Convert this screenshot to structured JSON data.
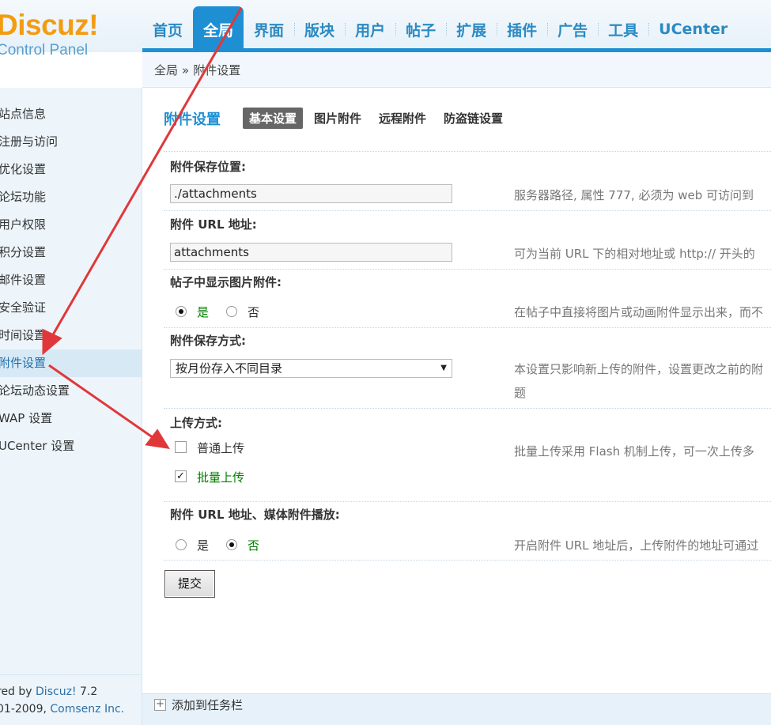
{
  "logo": {
    "brand": "Discuz!",
    "subtitle": "Control Panel"
  },
  "nav": {
    "items": [
      "首页",
      "全局",
      "界面",
      "版块",
      "用户",
      "帖子",
      "扩展",
      "插件",
      "广告",
      "工具",
      "UCenter"
    ],
    "active_index": 1
  },
  "breadcrumb": {
    "root": "全局",
    "separator": "»",
    "current": "附件设置"
  },
  "sidebar": {
    "items": [
      "站点信息",
      "注册与访问",
      "优化设置",
      "论坛功能",
      "用户权限",
      "积分设置",
      "邮件设置",
      "安全验证",
      "时间设置",
      "附件设置",
      "论坛动态设置",
      "WAP 设置",
      "UCenter 设置"
    ],
    "active_index": 9
  },
  "copyright": {
    "line1_prefix": "red by ",
    "line1_link": "Discuz!",
    "line1_suffix": " 7.2",
    "line2_prefix": "01-2009, ",
    "line2_link": "Comsenz Inc."
  },
  "page": {
    "title": "附件设置",
    "tabs": [
      "基本设置",
      "图片附件",
      "远程附件",
      "防盗链设置"
    ],
    "active_tab": 0
  },
  "form": {
    "save_path": {
      "label": "附件保存位置:",
      "value": "./attachments",
      "hint": "服务器路径, 属性 777, 必须为 web 可访问到"
    },
    "url": {
      "label": "附件 URL 地址:",
      "value": "attachments",
      "hint": "可为当前 URL 下的相对地址或 http:// 开头的"
    },
    "show_images": {
      "label": "帖子中显示图片附件:",
      "yes": "是",
      "no": "否",
      "selected": "yes",
      "hint": "在帖子中直接将图片或动画附件显示出来，而不"
    },
    "save_mode": {
      "label": "附件保存方式:",
      "value": "按月份存入不同目录",
      "hint_line1": "本设置只影响新上传的附件，设置更改之前的附",
      "hint_line2": "题"
    },
    "upload_mode": {
      "label": "上传方式:",
      "normal": "普通上传",
      "batch": "批量上传",
      "normal_checked": false,
      "batch_checked": true,
      "hint": "批量上传采用 Flash 机制上传，可一次上传多"
    },
    "media_play": {
      "label": "附件 URL 地址、媒体附件播放:",
      "yes": "是",
      "no": "否",
      "selected": "no",
      "hint": "开启附件 URL 地址后，上传附件的地址可通过"
    },
    "submit": "提交"
  },
  "taskbar": {
    "add_label": "添加到任务栏"
  },
  "colors": {
    "accent": "#1f8fd4",
    "logo": "#f39c12",
    "annotation": "#e0383a"
  }
}
